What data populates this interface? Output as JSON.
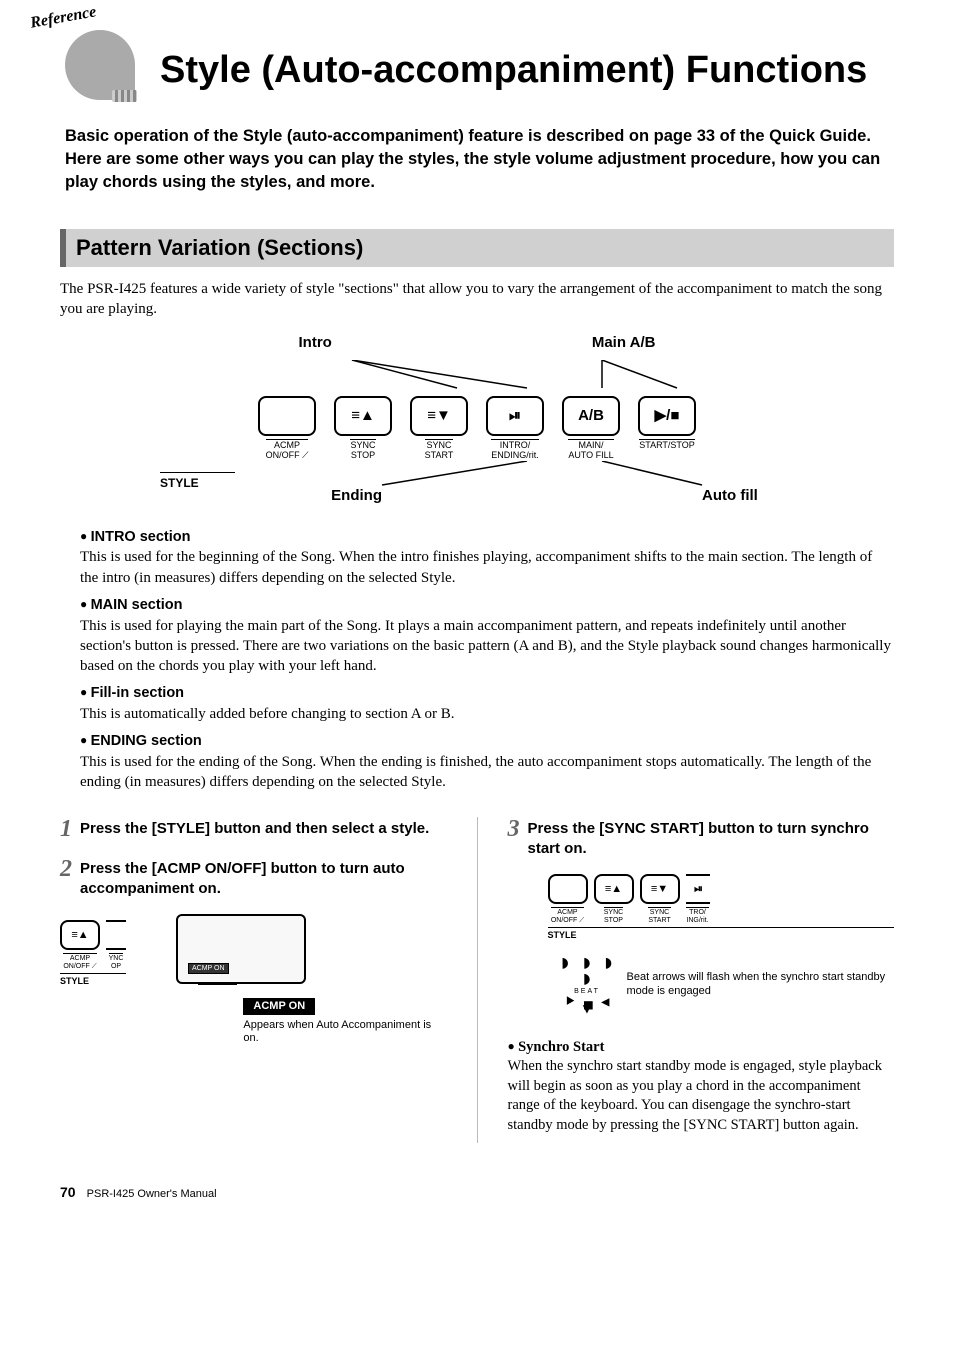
{
  "header": {
    "badge_text": "Reference",
    "title": "Style (Auto-accompaniment) Functions"
  },
  "intro": {
    "line1": "Basic operation of the Style (auto-accompaniment) feature is described on page 33 of the Quick Guide.",
    "line2": "Here are some other ways you can play the styles, the style volume adjustment procedure, how you can play chords using the styles, and more."
  },
  "section": {
    "title": "Pattern Variation (Sections)",
    "lead": "The PSR-I425 features a wide variety of style \"sections\" that allow you to vary the arrangement of the accompaniment to match the song you are playing."
  },
  "diagram": {
    "top_left": "Intro",
    "top_right": "Main A/B",
    "bottom_left": "Ending",
    "bottom_right": "Auto fill",
    "style_label": "STYLE",
    "buttons": [
      {
        "symbol": "",
        "label": "ACMP\nON/OFF ⟋"
      },
      {
        "symbol": "≡▲",
        "label": "SYNC\nSTOP"
      },
      {
        "symbol": "≡▼",
        "label": "SYNC\nSTART"
      },
      {
        "symbol": "⏯",
        "label": "INTRO/\nENDING/rit."
      },
      {
        "symbol": "A/B",
        "label": "MAIN/\nAUTO FILL"
      },
      {
        "symbol": "▶/■",
        "label": "START/STOP"
      }
    ]
  },
  "bullets": [
    {
      "head": "INTRO section",
      "body": "This is used for the beginning of the Song. When the intro finishes playing, accompaniment shifts to the main section. The length of the intro (in measures) differs depending on the selected Style."
    },
    {
      "head": "MAIN section",
      "body": "This is used for playing the main part of the Song. It plays a main accompaniment pattern, and repeats indefinitely until another section's button is pressed. There are two variations on the basic pattern (A and B), and the Style playback sound changes harmonically based on the chords you play with your left hand."
    },
    {
      "head": "Fill-in section",
      "body": "This is automatically added before changing to section A or B."
    },
    {
      "head": "ENDING section",
      "body": "This is used for the ending of the Song. When the ending is finished, the auto accompaniment stops automatically. The length of the ending (in measures) differs depending on the selected Style."
    }
  ],
  "steps": {
    "s1": "Press the [STYLE] button and then select a style.",
    "s2": "Press the [ACMP ON/OFF] button to turn auto accompaniment on.",
    "s3": "Press the [SYNC START] button to turn synchro start on."
  },
  "step2_fig": {
    "acmp_pill": "ACMP ON",
    "acmp_badge": "ACMP ON",
    "caption": "Appears when Auto Accompaniment is on.",
    "style_label": "STYLE",
    "btn1_label": "ACMP\nON/OFF ⟋",
    "btn2_label": "YNC\nOP"
  },
  "step3_fig": {
    "style_label": "STYLE",
    "btns": [
      {
        "symbol": "",
        "label": "ACMP\nON/OFF ⟋"
      },
      {
        "symbol": "≡▲",
        "label": "SYNC\nSTOP"
      },
      {
        "symbol": "≡▼",
        "label": "SYNC\nSTART"
      },
      {
        "symbol": "⏯",
        "label": "TRO/\nING/rit."
      }
    ],
    "beat_label": "BEAT",
    "beat_caption": "Beat arrows will flash when the synchro start standby mode is engaged"
  },
  "synchro": {
    "head": "Synchro Start",
    "body": "When the synchro start standby mode is engaged, style playback will begin as soon as you play a chord in the accompaniment range of the keyboard. You can disengage the synchro-start standby mode by pressing the [SYNC START] button again."
  },
  "footer": {
    "page": "70",
    "book": "PSR-I425  Owner's Manual"
  }
}
